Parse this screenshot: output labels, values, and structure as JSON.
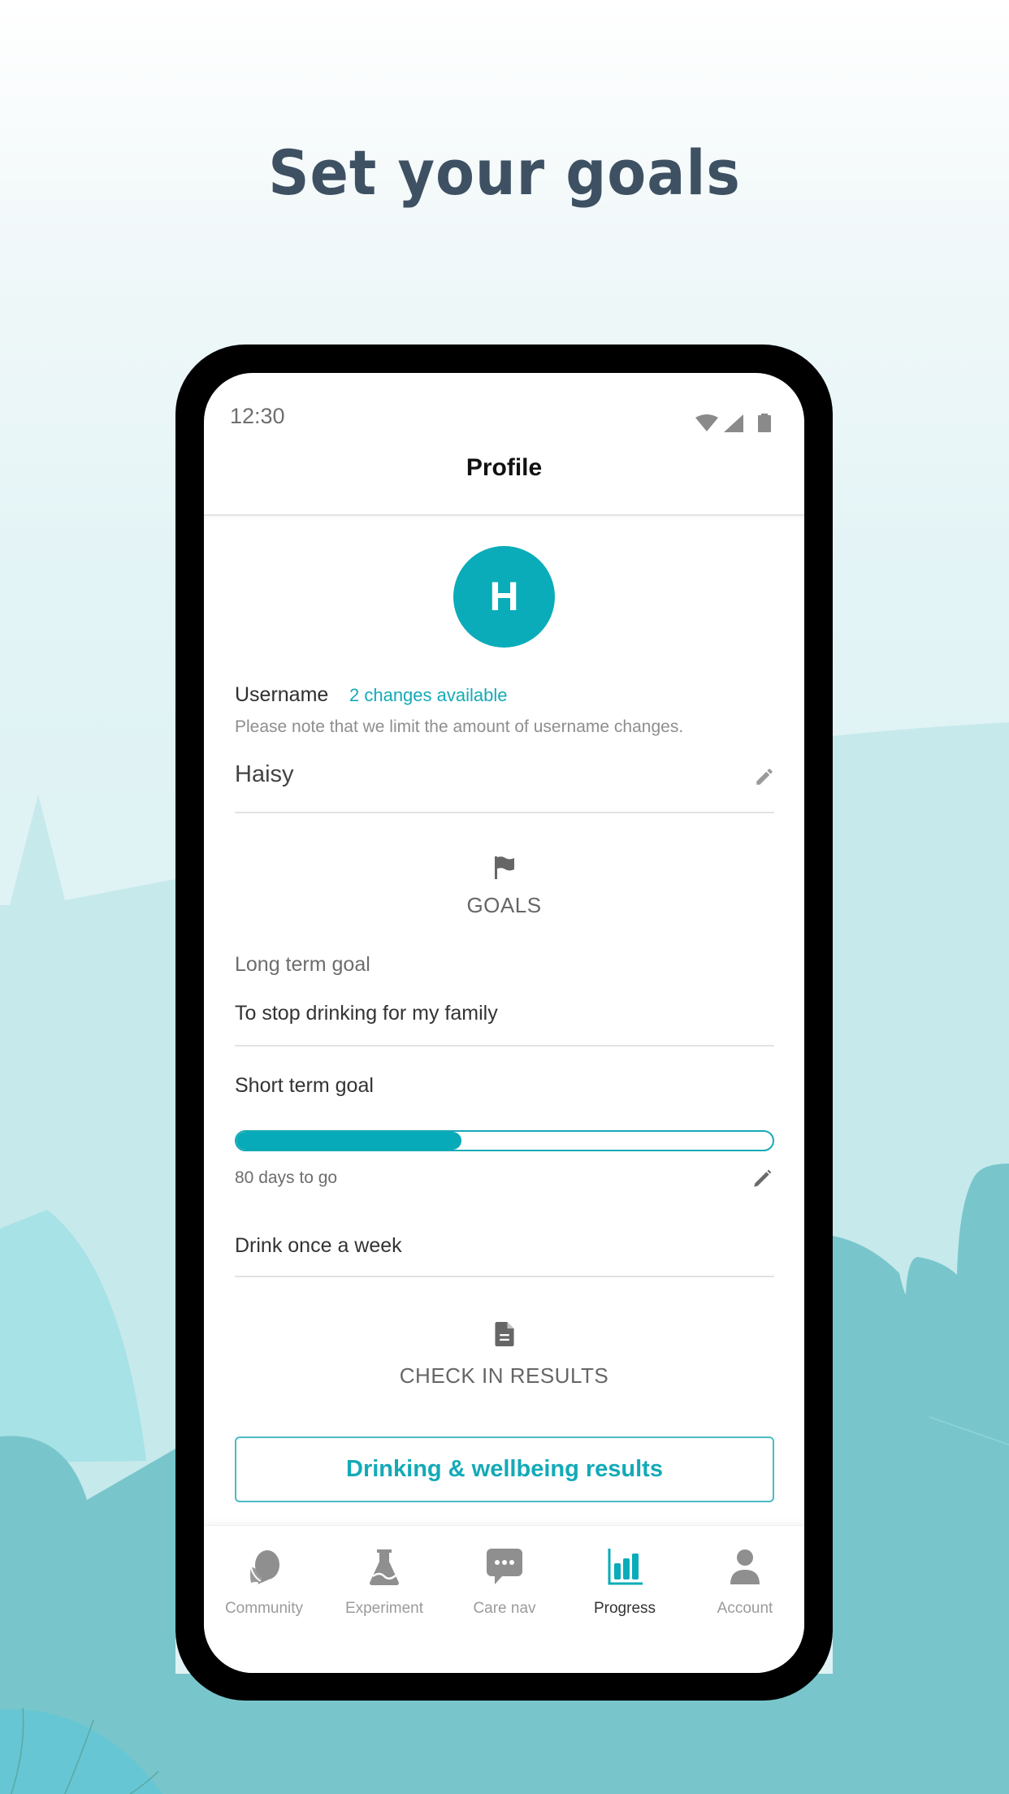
{
  "headline": "Set your goals",
  "colors": {
    "brand_teal": "#0aacb9",
    "headline": "#3e5163",
    "inactive_icon": "#8f8f8f",
    "background_teal": "#78c6cb"
  },
  "status_bar": {
    "time": "12:30",
    "icons": [
      "wifi-icon",
      "signal-icon",
      "battery-icon"
    ]
  },
  "header": {
    "title": "Profile"
  },
  "profile": {
    "avatar_initial": "H",
    "username_label": "Username",
    "changes_available": "2 changes available",
    "note": "Please note that we limit the amount of username changes.",
    "username_value": "Haisy",
    "edit_icon": "pencil-icon"
  },
  "goals": {
    "icon": "flag-icon",
    "section_title": "GOALS",
    "long_term_label": "Long term goal",
    "long_term_value": "To stop drinking for my family",
    "short_term_label": "Short term goal",
    "progress_fraction": 0.42,
    "days_remaining": "80 days to go",
    "edit_icon": "pencil-icon",
    "short_term_value": "Drink once a week"
  },
  "check_in": {
    "icon": "document-icon",
    "section_title": "CHECK IN RESULTS",
    "button_label": "Drinking & wellbeing results"
  },
  "nav": {
    "items": [
      {
        "label": "Community",
        "icon": "community-icon",
        "active": false
      },
      {
        "label": "Experiment",
        "icon": "flask-icon",
        "active": false
      },
      {
        "label": "Care nav",
        "icon": "chat-icon",
        "active": false
      },
      {
        "label": "Progress",
        "icon": "bar-chart-icon",
        "active": true
      },
      {
        "label": "Account",
        "icon": "person-icon",
        "active": false
      }
    ]
  }
}
